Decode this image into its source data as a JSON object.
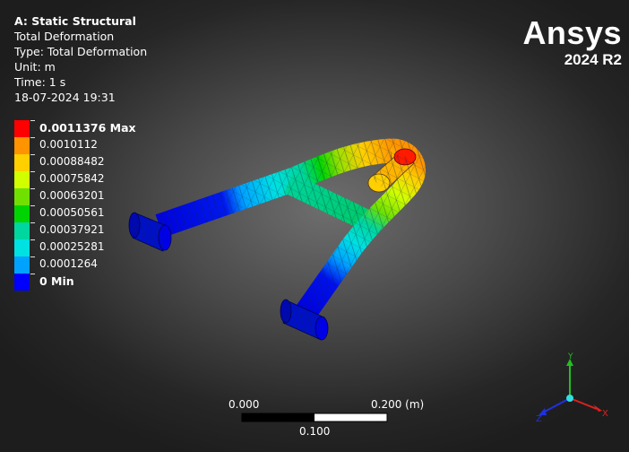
{
  "header": {
    "title": "A: Static Structural",
    "result_name": "Total Deformation",
    "type_line": "Type: Total Deformation",
    "unit_line": "Unit: m",
    "time_line": "Time: 1 s",
    "date_line": "18-07-2024 19:31"
  },
  "brand": {
    "logo": "Ansys",
    "version": "2024 R2"
  },
  "legend": [
    {
      "label": "0.0011376 Max",
      "color": "#ff0000",
      "bold": true
    },
    {
      "label": "0.0010112",
      "color": "#ff9400"
    },
    {
      "label": "0.00088482",
      "color": "#ffcf00"
    },
    {
      "label": "0.00075842",
      "color": "#d2ff00"
    },
    {
      "label": "0.00063201",
      "color": "#70e000"
    },
    {
      "label": "0.00050561",
      "color": "#00d400"
    },
    {
      "label": "0.00037921",
      "color": "#00d7a0"
    },
    {
      "label": "0.00025281",
      "color": "#00e1e1"
    },
    {
      "label": "0.0001264",
      "color": "#00a2ff"
    },
    {
      "label": "0 Min",
      "color": "#0000ff",
      "bold": true
    }
  ],
  "scale_bar": {
    "left_label": "0.000",
    "right_label": "0.200 (m)",
    "mid_label": "0.100"
  },
  "triad": {
    "x_label": "X",
    "y_label": "Y",
    "z_label": "Z",
    "x_color": "#e02020",
    "y_color": "#20c020",
    "z_color": "#2030e0"
  }
}
